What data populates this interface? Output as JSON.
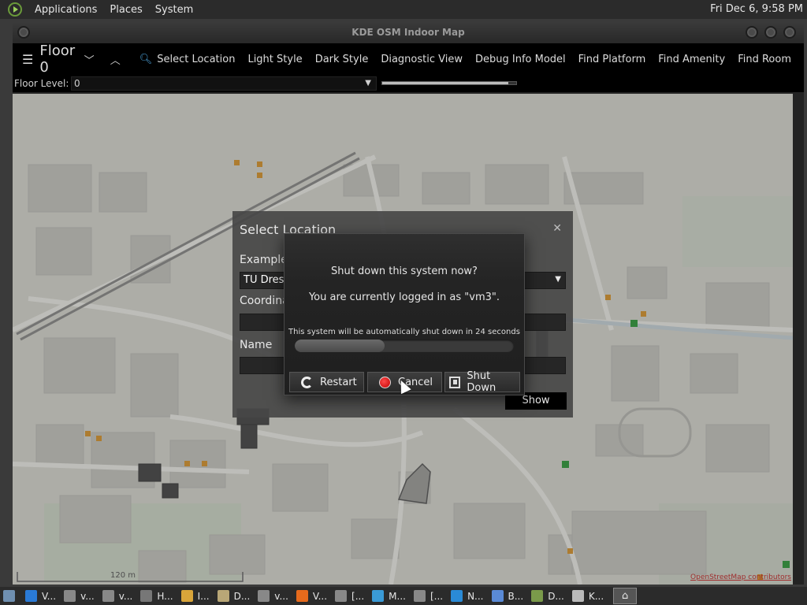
{
  "top_panel": {
    "menus": [
      "Applications",
      "Places",
      "System"
    ],
    "clock": "Fri Dec 6,  9:58 PM"
  },
  "window": {
    "title": "KDE OSM Indoor Map"
  },
  "toolbar": {
    "floor": "Floor 0",
    "select_location": "Select Location",
    "items": [
      "Light Style",
      "Dark Style",
      "Diagnostic View",
      "Debug Info Model",
      "Find Platform",
      "Find Amenity",
      "Find Room"
    ]
  },
  "floorbar": {
    "label": "Floor Level:",
    "value": "0",
    "slider_fraction": 0.94
  },
  "map": {
    "scale": "120 m",
    "attribution": "OpenStreetMap contributors"
  },
  "select_dialog": {
    "title": "Select Location",
    "example_label": "Examples",
    "example_value": "TU Dresden",
    "coord_label": "Coordinates",
    "name_label": "Name",
    "show_button": "Show"
  },
  "shutdown_dialog": {
    "question": "Shut down this system now?",
    "logged_in": "You are currently logged in as \"vm3\".",
    "auto_text": "This system will be automatically shut down in 24 seconds",
    "progress_fraction": 0.41,
    "restart": "Restart",
    "cancel": "Cancel",
    "shutdown": "Shut Down"
  },
  "taskbar": {
    "tasks": [
      {
        "label": "V...",
        "color": "#2a7ad6"
      },
      {
        "label": "v...",
        "color": "#888"
      },
      {
        "label": "v...",
        "color": "#888"
      },
      {
        "label": "H...",
        "color": "#777"
      },
      {
        "label": "I...",
        "color": "#d9a53a"
      },
      {
        "label": "D...",
        "color": "#b9a777"
      },
      {
        "label": "v...",
        "color": "#888"
      },
      {
        "label": "V...",
        "color": "#e66a1c"
      },
      {
        "label": "[...",
        "color": "#888"
      },
      {
        "label": "M...",
        "color": "#3a9ad6"
      },
      {
        "label": "[...",
        "color": "#888"
      },
      {
        "label": "N...",
        "color": "#2a8ad6"
      },
      {
        "label": "B...",
        "color": "#5a8ad6"
      },
      {
        "label": "D...",
        "color": "#7a9a4a"
      },
      {
        "label": "K...",
        "color": "#bbb"
      }
    ]
  }
}
